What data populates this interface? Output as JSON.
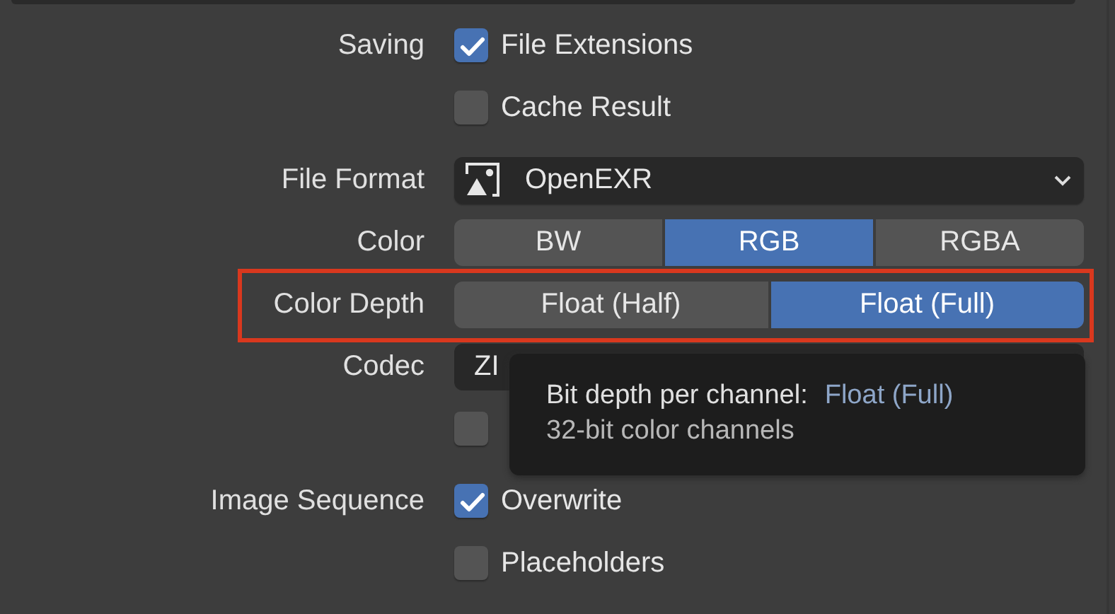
{
  "sections": [
    {
      "rows": [
        {
          "label": "Saving",
          "kind": "checkbox",
          "text": "File Extensions",
          "checked": true
        },
        {
          "kind": "checkbox",
          "text": "Cache Result",
          "checked": false
        }
      ]
    },
    {
      "rows": [
        {
          "label": "File Format",
          "kind": "dropdown",
          "value": "OpenEXR"
        },
        {
          "label": "Color",
          "kind": "segmented",
          "options": [
            {
              "label": "BW",
              "selected": false
            },
            {
              "label": "RGB",
              "selected": true
            },
            {
              "label": "RGBA",
              "selected": false
            }
          ]
        },
        {
          "label": "Color Depth",
          "kind": "segmented",
          "highlighted": true,
          "options": [
            {
              "label": "Float (Half)",
              "selected": false
            },
            {
              "label": "Float (Full)",
              "selected": true
            }
          ]
        },
        {
          "label": "Codec",
          "kind": "field",
          "value": "ZI"
        },
        {
          "kind": "checkbox",
          "checked": false
        }
      ]
    },
    {
      "rows": [
        {
          "label": "Image Sequence",
          "kind": "checkbox",
          "text": "Overwrite",
          "checked": true
        },
        {
          "kind": "checkbox",
          "text": "Placeholders",
          "checked": false
        }
      ]
    }
  ],
  "tooltip": {
    "title": "Bit depth per channel:",
    "value": "Float (Full)",
    "description": "32-bit color channels"
  }
}
